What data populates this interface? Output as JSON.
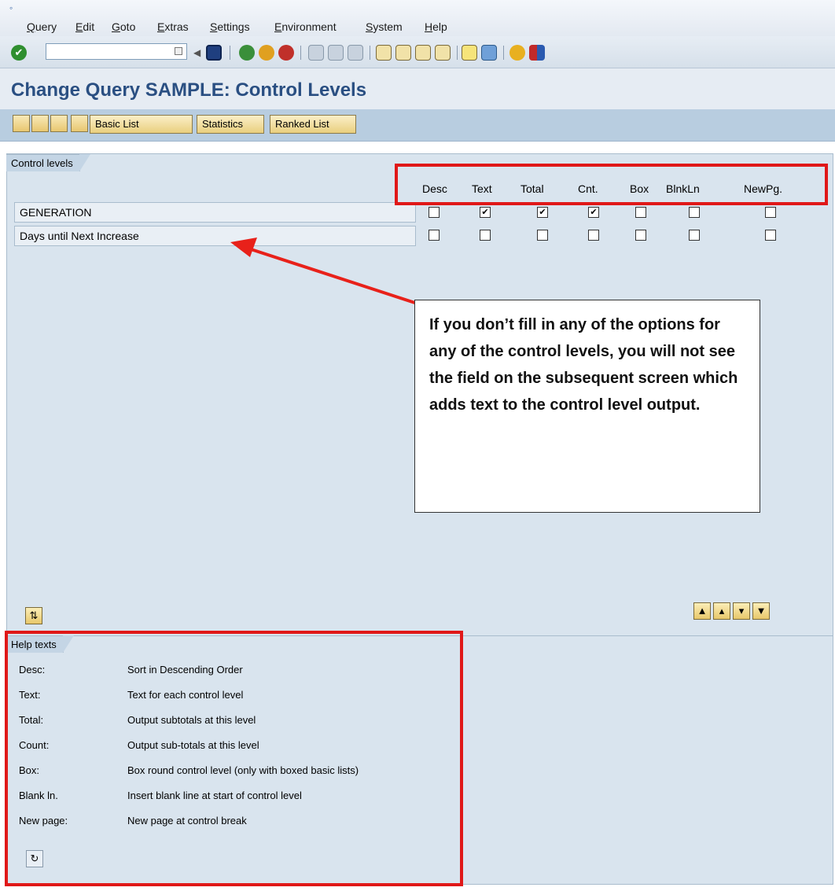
{
  "menu": {
    "items": [
      "Query",
      "Edit",
      "Goto",
      "Extras",
      "Settings",
      "Environment",
      "System",
      "Help"
    ]
  },
  "toolbar": {
    "command_field_value": "",
    "icons": [
      "enter-icon",
      "back-icon",
      "save-icon",
      "back-green-icon",
      "exit-icon",
      "cancel-icon",
      "print-icon",
      "find-icon",
      "find-next-icon",
      "first-page-icon",
      "previous-page-icon",
      "next-page-icon",
      "last-page-icon",
      "create-session-icon",
      "shortcut-icon",
      "help-icon",
      "layout-icon"
    ]
  },
  "title": "Change Query SAMPLE: Control Levels",
  "app_toolbar": {
    "icons": [
      "previous-screen-icon",
      "next-screen-icon",
      "list-icon",
      "output-icon"
    ],
    "buttons": [
      "Basic List",
      "Statistics",
      "Ranked List"
    ]
  },
  "control_levels": {
    "tab_label": "Control levels",
    "columns": [
      "Desc",
      "Text",
      "Total",
      "Cnt.",
      "Box",
      "BlnkLn",
      "NewPg."
    ],
    "rows": [
      {
        "label": "GENERATION",
        "checked": [
          false,
          true,
          true,
          true,
          false,
          false,
          false
        ]
      },
      {
        "label": "Days until Next Increase",
        "checked": [
          false,
          false,
          false,
          false,
          false,
          false,
          false
        ]
      }
    ]
  },
  "callout": {
    "text": "If you don’t fill in any of the options for any of the control levels, you will not see the field on the subsequent screen which adds text to the control level output."
  },
  "help_texts": {
    "tab_label": "Help texts",
    "items": [
      {
        "key": "Desc:",
        "value": "Sort in Descending Order"
      },
      {
        "key": "Text:",
        "value": "Text for each control level"
      },
      {
        "key": "Total:",
        "value": "Output subtotals at this level"
      },
      {
        "key": "Count:",
        "value": "Output sub-totals at this level"
      },
      {
        "key": "Box:",
        "value": "Box round control level (only with boxed basic lists)"
      },
      {
        "key": "Blank ln.",
        "value": "Insert blank line at start of control level"
      },
      {
        "key": "New page:",
        "value": "New page at control break"
      }
    ]
  },
  "colors": {
    "title_blue": "#2a4f82",
    "annotation_red": "#e01818",
    "panel_bg": "#d9e4ee"
  }
}
